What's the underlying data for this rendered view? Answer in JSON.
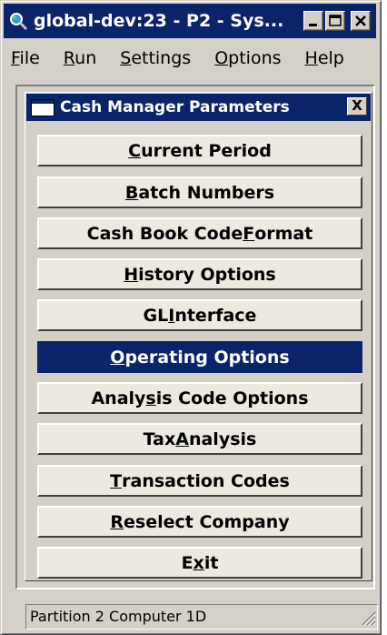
{
  "window": {
    "title": "global-dev:23 - P2 - Sys...",
    "title_icon": "magnifier-globe-icon",
    "controls": [
      "minimize-icon",
      "maximize-icon",
      "close-icon"
    ]
  },
  "menubar": {
    "items": [
      {
        "key": "F",
        "rest": "ile"
      },
      {
        "key": "R",
        "rest": "un"
      },
      {
        "key": "S",
        "rest": "ettings"
      },
      {
        "key": "O",
        "rest": "ptions"
      },
      {
        "key": "H",
        "rest": "elp"
      }
    ]
  },
  "dialog": {
    "title": "Cash Manager Parameters",
    "close_glyph": "X",
    "buttons": [
      {
        "pre": "",
        "key": "C",
        "post": "urrent Period",
        "selected": false
      },
      {
        "pre": "",
        "key": "B",
        "post": "atch Numbers",
        "selected": false
      },
      {
        "pre": "Cash Book Code ",
        "key": "F",
        "post": "ormat",
        "selected": false
      },
      {
        "pre": "",
        "key": "H",
        "post": "istory Options",
        "selected": false
      },
      {
        "pre": "GL ",
        "key": "I",
        "post": "nterface",
        "selected": false
      },
      {
        "pre": "",
        "key": "O",
        "post": "perating Options",
        "selected": true
      },
      {
        "pre": "Analy",
        "key": "s",
        "post": "is Code Options",
        "selected": false
      },
      {
        "pre": "Tax ",
        "key": "A",
        "post": "nalysis",
        "selected": false
      },
      {
        "pre": "",
        "key": "T",
        "post": "ransaction Codes",
        "selected": false
      },
      {
        "pre": "",
        "key": "R",
        "post": "eselect Company",
        "selected": false
      },
      {
        "pre": "E",
        "key": "x",
        "post": "it",
        "selected": false
      }
    ]
  },
  "statusbar": {
    "text": "Partition 2 Computer 1D"
  },
  "colors": {
    "titlebar": "#0a246a",
    "face": "#d4d0c8",
    "selected": "#0a246a"
  }
}
